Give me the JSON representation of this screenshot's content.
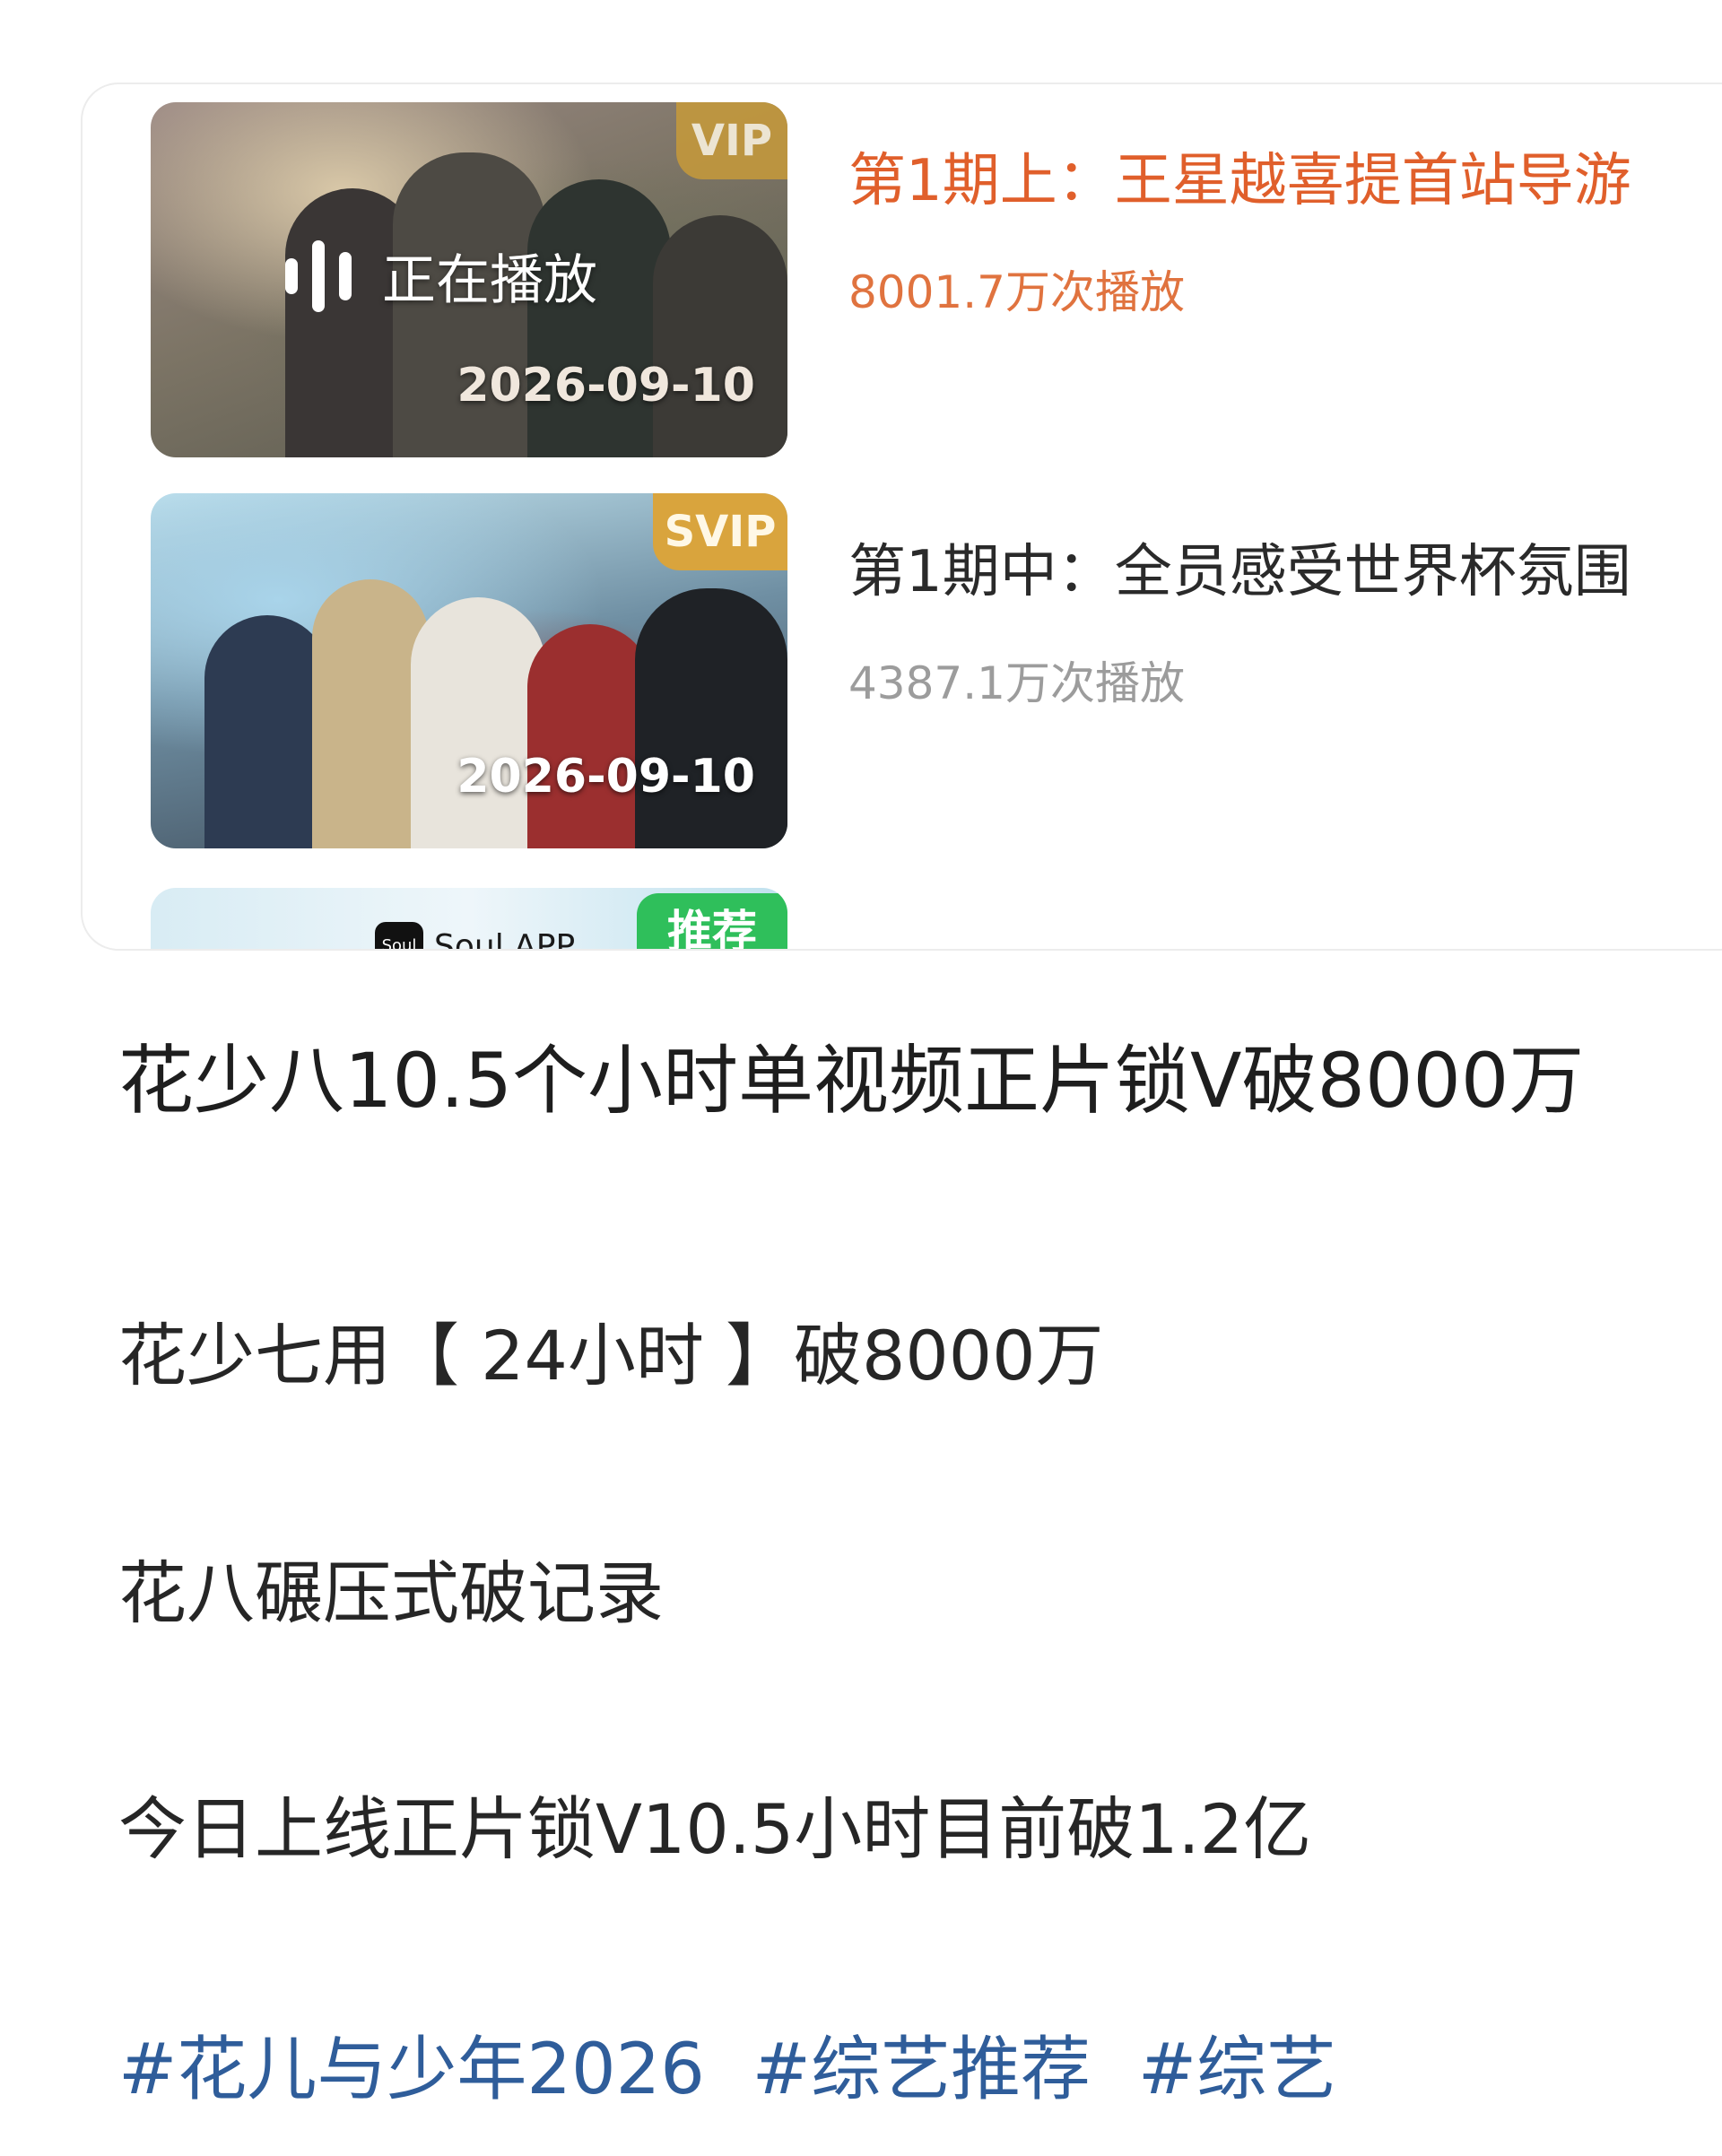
{
  "colors": {
    "accent_orange": "#e05f2b",
    "hashtag_blue": "#2f5d9a",
    "vip_gold": "#c79a3a",
    "recommend_green": "#2fbf5b"
  },
  "episodes": [
    {
      "badge": "VIP",
      "playing_label": "正在播放",
      "date": "2026-09-10",
      "title": "第1期上：王星越喜提首站导游",
      "plays": "8001.7万次播放"
    },
    {
      "badge": "SVIP",
      "date": "2026-09-10",
      "title": "第1期中：全员感受世界杯氛围",
      "plays": "4387.1万次播放"
    },
    {
      "badge": "推荐",
      "brand": "Soul APP",
      "brand_mark": "Soul"
    }
  ],
  "post": {
    "title": "花少八10.5个小时单视频正片锁V破8000万",
    "lines": [
      "花少七用【 24小时 】破8000万",
      "花八碾压式破记录",
      "今日上线正片锁V10.5小时目前破1.2亿"
    ],
    "hashtags": [
      "#花儿与少年2026",
      "#综艺推荐",
      "#综艺"
    ]
  }
}
